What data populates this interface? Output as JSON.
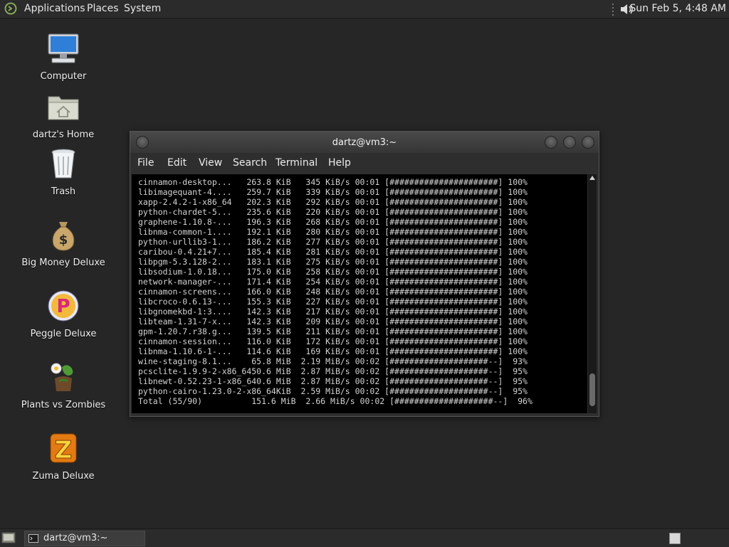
{
  "top_panel": {
    "menus": [
      "Applications",
      "Places",
      "System"
    ],
    "clock": "Sun Feb  5,  4:48 AM",
    "volume_icon": "speaker-icon"
  },
  "desktop_icons": [
    {
      "label": "Computer",
      "icon": "computer-icon"
    },
    {
      "label": "dartz's Home",
      "icon": "home-folder-icon"
    },
    {
      "label": "Trash",
      "icon": "trash-icon"
    },
    {
      "label": "Big Money Deluxe",
      "icon": "money-bag-icon"
    },
    {
      "label": "Peggle Deluxe",
      "icon": "peggle-icon"
    },
    {
      "label": "Plants vs Zombies",
      "icon": "plants-vs-zombies-icon"
    },
    {
      "label": "Zuma Deluxe",
      "icon": "zuma-icon"
    }
  ],
  "terminal": {
    "title": "dartz@vm3:~",
    "menu": [
      "File",
      "Edit",
      "View",
      "Search",
      "Terminal",
      "Help"
    ],
    "lines": [
      "cinnamon-desktop...   263.8 KiB   345 KiB/s 00:01 [######################] 100%",
      "libimagequant-4....   259.7 KiB   339 KiB/s 00:01 [######################] 100%",
      "xapp-2.4.2-1-x86_64   202.3 KiB   292 KiB/s 00:01 [######################] 100%",
      "python-chardet-5...   235.6 KiB   220 KiB/s 00:01 [######################] 100%",
      "graphene-1.10.8-...   196.3 KiB   268 KiB/s 00:01 [######################] 100%",
      "libnma-common-1....   192.1 KiB   280 KiB/s 00:01 [######################] 100%",
      "python-urllib3-1...   186.2 KiB   277 KiB/s 00:01 [######################] 100%",
      "caribou-0.4.21+7...   185.4 KiB   281 KiB/s 00:01 [######################] 100%",
      "libpgm-5.3.128-2...   183.1 KiB   275 KiB/s 00:01 [######################] 100%",
      "libsodium-1.0.18...   175.0 KiB   258 KiB/s 00:01 [######################] 100%",
      "network-manager-...   171.4 KiB   254 KiB/s 00:01 [######################] 100%",
      "cinnamon-screens...   166.0 KiB   248 KiB/s 00:01 [######################] 100%",
      "libcroco-0.6.13-...   155.3 KiB   227 KiB/s 00:01 [######################] 100%",
      "libgnomekbd-1:3....   142.3 KiB   217 KiB/s 00:01 [######################] 100%",
      "libteam-1.31-7-x...   142.3 KiB   209 KiB/s 00:01 [######################] 100%",
      "gpm-1.20.7.r38.g...   139.5 KiB   211 KiB/s 00:01 [######################] 100%",
      "cinnamon-session...   116.0 KiB   172 KiB/s 00:01 [######################] 100%",
      "libnma-1.10.6-1-...   114.6 KiB   169 KiB/s 00:01 [######################] 100%",
      "wine-staging-8.1...    65.8 MiB  2.19 MiB/s 00:02 [####################--]  93%",
      "pcsclite-1.9.9-2-x86_6450.6 MiB  2.87 MiB/s 00:02 [####################--]  95%",
      "libnewt-0.52.23-1-x86_640.6 MiB  2.87 MiB/s 00:02 [####################--]  95%",
      "python-cairo-1.23.0-2-x86_64KiB  2.59 MiB/s 00:02 [####################--]  95%",
      "Total (55/90)          151.6 MiB  2.66 MiB/s 00:02 [####################--]  96%"
    ]
  },
  "taskbar": {
    "task_label": "dartz@vm3:~",
    "task_icon": "terminal-icon"
  }
}
